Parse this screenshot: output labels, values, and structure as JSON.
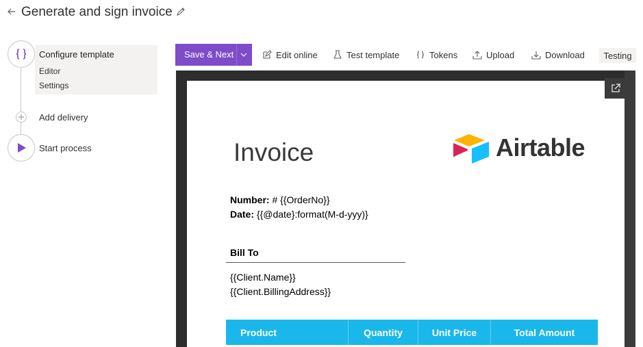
{
  "header": {
    "title": "Generate and sign invoice"
  },
  "stepper": {
    "steps": [
      {
        "label": "Configure template",
        "icon": "curly-braces-icon",
        "sub_items": [
          "Editor",
          "Settings"
        ]
      },
      {
        "label": "Add delivery",
        "icon": "plus-icon"
      },
      {
        "label": "Start process",
        "icon": "play-icon"
      }
    ]
  },
  "toolbar": {
    "save_label": "Save & Next",
    "edit_online": "Edit online",
    "test_template": "Test template",
    "tokens": "Tokens",
    "upload": "Upload",
    "download": "Download",
    "testing": "Testing"
  },
  "document": {
    "title": "Invoice",
    "logo_text": "Airtable",
    "number_label": "Number:",
    "number_value": " # {{OrderNo}}",
    "date_label": "Date:",
    "date_value": " {{@date}:format(M-d-yyy)}",
    "bill_to": "Bill To",
    "client_name": "{{Client.Name}}",
    "client_address": "{{Client.BillingAddress}}",
    "table_headers": [
      "Product",
      "Quantity",
      "Unit Price",
      "Total Amount"
    ]
  },
  "colors": {
    "accent": "#7e4bc9",
    "table_header": "#1ab7ea"
  }
}
